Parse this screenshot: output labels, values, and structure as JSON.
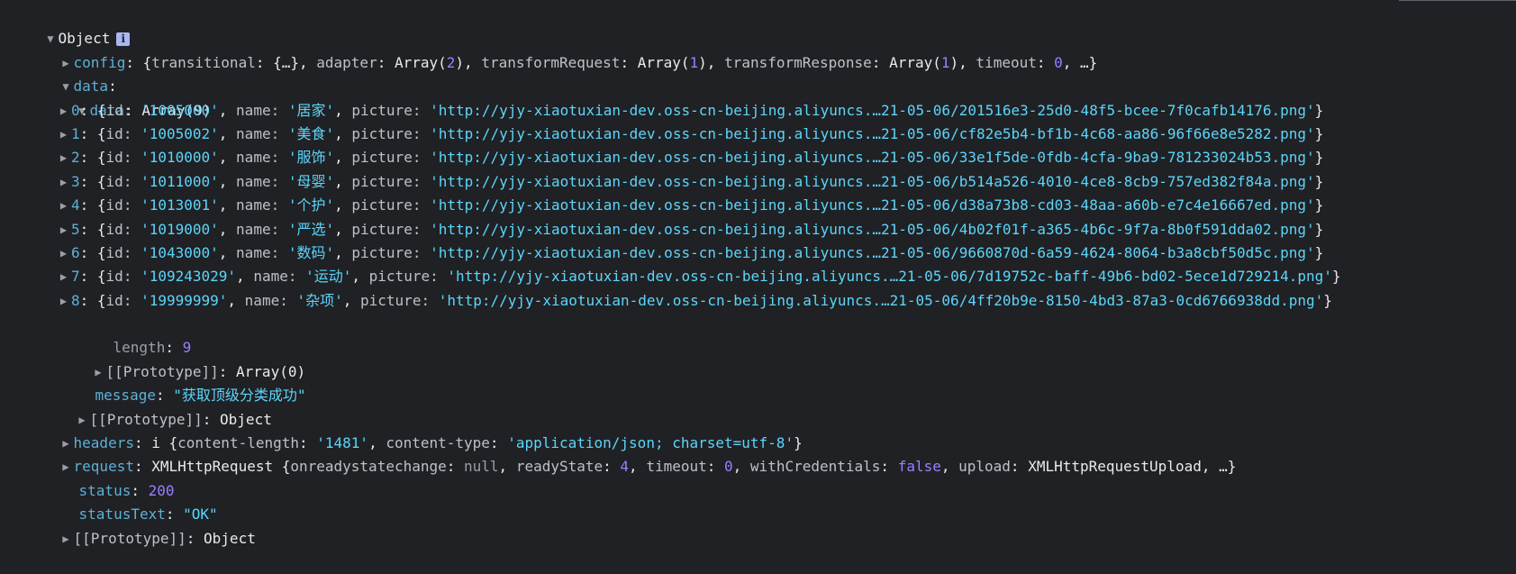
{
  "console": {
    "root_label": "Object",
    "info_glyph": "i",
    "config": {
      "key": "config",
      "preview": "{transitional: {…}, adapter: Array(2), transformRequest: Array(1), transformResponse: Array(1), timeout: 0, …}"
    },
    "data": {
      "key": "data",
      "inner_key": "data",
      "inner_type": "Array(9)",
      "items": [
        {
          "index": "0",
          "id": "'1005000'",
          "name": "'居家'",
          "picture": "'http://yjy-xiaotuxian-dev.oss-cn-beijing.aliyuncs.…21-05-06/201516e3-25d0-48f5-bcee-7f0cafb14176.png'"
        },
        {
          "index": "1",
          "id": "'1005002'",
          "name": "'美食'",
          "picture": "'http://yjy-xiaotuxian-dev.oss-cn-beijing.aliyuncs.…21-05-06/cf82e5b4-bf1b-4c68-aa86-96f66e8e5282.png'"
        },
        {
          "index": "2",
          "id": "'1010000'",
          "name": "'服饰'",
          "picture": "'http://yjy-xiaotuxian-dev.oss-cn-beijing.aliyuncs.…21-05-06/33e1f5de-0fdb-4cfa-9ba9-781233024b53.png'"
        },
        {
          "index": "3",
          "id": "'1011000'",
          "name": "'母婴'",
          "picture": "'http://yjy-xiaotuxian-dev.oss-cn-beijing.aliyuncs.…21-05-06/b514a526-4010-4ce8-8cb9-757ed382f84a.png'"
        },
        {
          "index": "4",
          "id": "'1013001'",
          "name": "'个护'",
          "picture": "'http://yjy-xiaotuxian-dev.oss-cn-beijing.aliyuncs.…21-05-06/d38a73b8-cd03-48aa-a60b-e7c4e16667ed.png'"
        },
        {
          "index": "5",
          "id": "'1019000'",
          "name": "'严选'",
          "picture": "'http://yjy-xiaotuxian-dev.oss-cn-beijing.aliyuncs.…21-05-06/4b02f01f-a365-4b6c-9f7a-8b0f591dda02.png'"
        },
        {
          "index": "6",
          "id": "'1043000'",
          "name": "'数码'",
          "picture": "'http://yjy-xiaotuxian-dev.oss-cn-beijing.aliyuncs.…21-05-06/9660870d-6a59-4624-8064-b3a8cbf50d5c.png'"
        },
        {
          "index": "7",
          "id": "'109243029'",
          "name": "'运动'",
          "picture": "'http://yjy-xiaotuxian-dev.oss-cn-beijing.aliyuncs.…21-05-06/7d19752c-baff-49b6-bd02-5ece1d729214.png'"
        },
        {
          "index": "8",
          "id": "'19999999'",
          "name": "'杂项'",
          "picture": "'http://yjy-xiaotuxian-dev.oss-cn-beijing.aliyuncs.…21-05-06/4ff20b9e-8150-4bd3-87a3-0cd6766938dd.png'"
        }
      ],
      "length_key": "length",
      "length_value": "9",
      "array_proto_key": "[[Prototype]]",
      "array_proto_value": "Array(0)",
      "message_key": "message",
      "message_value": "\"获取顶级分类成功\"",
      "proto_key": "[[Prototype]]",
      "proto_value": "Object"
    },
    "headers": {
      "key": "headers",
      "preview": "i {content-length: '1481', content-type: 'application/json; charset=utf-8'}"
    },
    "request": {
      "key": "request",
      "preview": "XMLHttpRequest {onreadystatechange: null, readyState: 4, timeout: 0, withCredentials: false, upload: XMLHttpRequestUpload, …}"
    },
    "status": {
      "key": "status",
      "value": "200"
    },
    "statusText": {
      "key": "statusText",
      "value": "\"OK\""
    },
    "proto": {
      "key": "[[Prototype]]",
      "value": "Object"
    },
    "colors": {
      "background": "#202124",
      "key": "#5db0d7",
      "string": "#5cd5fb",
      "number": "#9980ff",
      "text": "#e8eaed"
    }
  }
}
